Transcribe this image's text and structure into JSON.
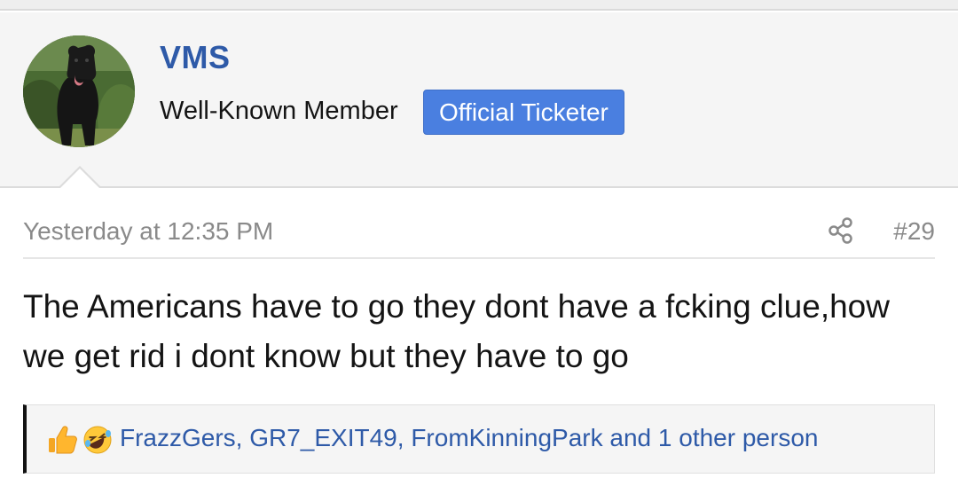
{
  "user": {
    "name": "VMS",
    "title": "Well-Known Member",
    "banner": "Official Ticketer",
    "avatar_icon": "dog-avatar"
  },
  "post": {
    "date": "Yesterday at 12:35 PM",
    "number": "#29",
    "body": "The Americans have to go they dont have a fcking clue,how we get rid i dont know but they have to go"
  },
  "reactions": {
    "icons": [
      "thumbs-up-icon",
      "laughing-face-icon"
    ],
    "users_text": "FrazzGers, GR7_EXIT49, FromKinningPark and 1 other person"
  },
  "colors": {
    "username": "#2e5aa8",
    "banner_bg": "#4a7fe0",
    "meta_text": "#8a8a8a",
    "link": "#2e5aa8"
  }
}
